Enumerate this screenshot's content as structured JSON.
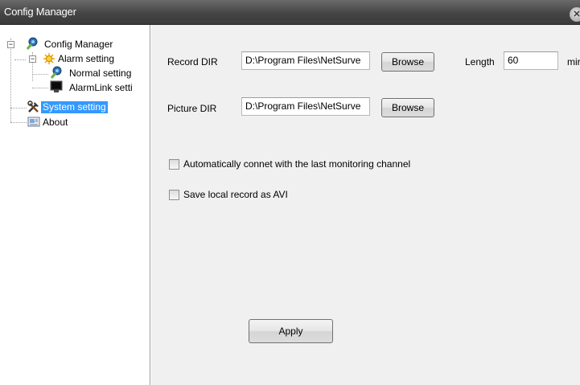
{
  "window": {
    "title": "Config Manager",
    "close_glyph": "✕"
  },
  "tree": {
    "items": [
      {
        "label": "Config Manager",
        "icon": "config-manager-icon",
        "expander": "−"
      },
      {
        "label": "Alarm setting",
        "icon": "alarm-icon",
        "expander": "−"
      },
      {
        "label": "Normal setting",
        "icon": "normal-setting-icon"
      },
      {
        "label": "AlarmLink setti",
        "icon": "alarmlink-monitor-icon"
      },
      {
        "label": "System setting",
        "icon": "tools-icon",
        "selected": true
      },
      {
        "label": "About",
        "icon": "about-icon"
      }
    ]
  },
  "form": {
    "record_dir": {
      "label": "Record DIR",
      "value": "D:\\Program Files\\NetSurve"
    },
    "browse_record": "Browse",
    "length": {
      "label": "Length",
      "value": "60",
      "unit": "mir"
    },
    "picture_dir": {
      "label": "Picture DIR",
      "value": "D:\\Program Files\\NetSurve"
    },
    "browse_picture": "Browse",
    "auto_connect": {
      "label": "Automatically connet with the last monitoring channel",
      "checked": false
    },
    "save_avi": {
      "label": "Save local record as AVI",
      "checked": false
    },
    "apply": "Apply"
  },
  "colors": {
    "title_bar": "#454545",
    "selection": "#3399ff",
    "panel_bg": "#f0f0f0"
  }
}
